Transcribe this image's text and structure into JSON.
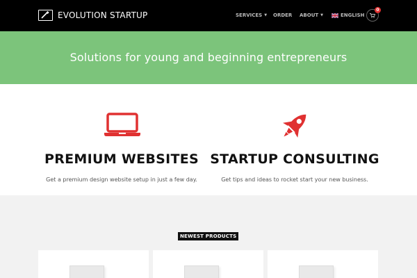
{
  "nav": {
    "brand": "EVOLUTION STARTUP",
    "items": [
      {
        "label": "SERVICES",
        "has_caret": true
      },
      {
        "label": "ORDER",
        "has_caret": false
      },
      {
        "label": "ABOUT",
        "has_caret": true
      },
      {
        "label": "ENGLISH",
        "icon": "uk-flag-icon"
      }
    ],
    "cart_count": "0"
  },
  "banner": {
    "text": "Solutions for young and beginning entrepreneurs",
    "color": "#7cc47b"
  },
  "features": [
    {
      "icon": "laptop-icon",
      "title": "PREMIUM WEBSITES",
      "desc": "Get a premium design website setup in just a few day."
    },
    {
      "icon": "rocket-icon",
      "title": "STARTUP CONSULTING",
      "desc": "Get tips and ideas to rocket start your new business."
    }
  ],
  "accent_color": "#e03131",
  "products": {
    "label": "NEWEST PRODUCTS",
    "cards": [
      {
        "icon": "product-box-icon"
      },
      {
        "icon": "product-box-icon"
      },
      {
        "icon": "product-box-icon"
      }
    ]
  }
}
